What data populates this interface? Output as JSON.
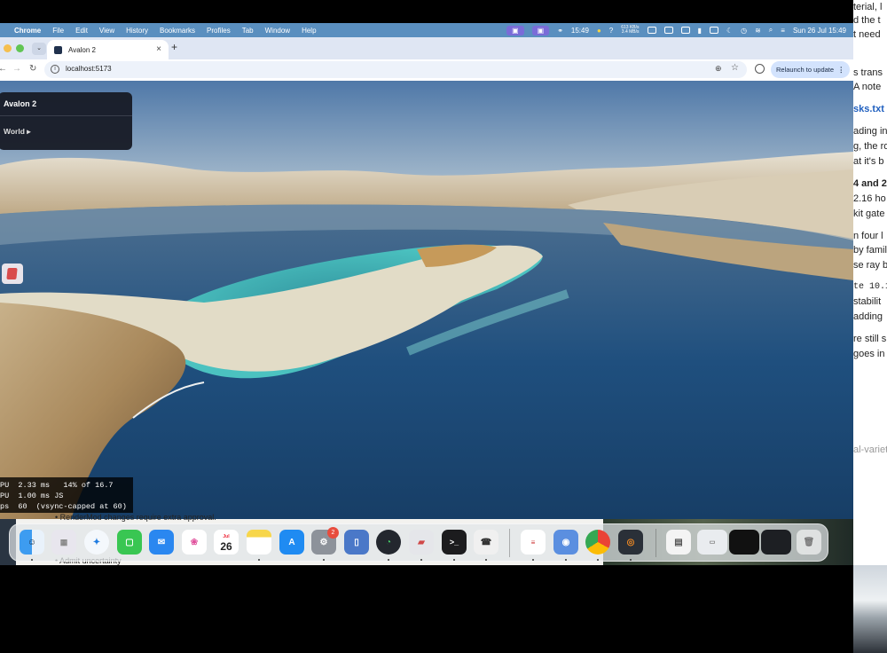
{
  "menubar": {
    "app": "Chrome",
    "items": [
      "File",
      "Edit",
      "View",
      "History",
      "Bookmarks",
      "Profiles",
      "Tab",
      "Window",
      "Help"
    ],
    "clock_short": "15:49",
    "net_up": "613 KB/s",
    "net_down": "3.4 MB/s",
    "datetime": "Sun 26 Jul  15:49"
  },
  "browser": {
    "tab_title": "Avalon 2",
    "url": "localhost:5173",
    "relaunch_label": "Relaunch to update"
  },
  "app": {
    "panel_title": "Avalon 2",
    "world_label": "World ▸",
    "stats": {
      "line1": "PU  2.33 ms   14% of 16.7",
      "line2": "PU  1.00 ms JS",
      "line3": "ps  60  (vsync-capped at 60)"
    }
  },
  "background_doc": {
    "lines": [
      "terial, l",
      "d the t",
      "t need",
      "s trans",
      "A note",
      "sks.txt",
      "ading in",
      "g, the ro",
      "at it's b",
      "4 and 2",
      "2.16 ho",
      "kit gate",
      "n four l",
      "by famil",
      "se ray b",
      "te 10.1",
      "stabilit",
      "adding",
      "re still s",
      "goes in",
      "al-variet"
    ]
  },
  "peek": {
    "text1": "• RenderMod changes require extra approval.",
    "text2": "• Admit uncertainty"
  },
  "dock": {
    "calendar_month": "Jul",
    "calendar_day": "26",
    "settings_badge": "2",
    "items": [
      "finder-icon",
      "launchpad-icon",
      "safari-icon",
      "messages-icon",
      "mail-icon",
      "photos-icon",
      "calendar-icon",
      "notes-icon",
      "app-store-icon",
      "system-settings-icon",
      "simulator-icon",
      "activity-icon",
      "xcode-icon",
      "terminal-icon",
      "phone-icon",
      "textedit-icon",
      "finder-helper-icon",
      "chrome-icon",
      "blender-icon",
      "preview-icon",
      "screenshot-icon",
      "window-thumb-icon",
      "window-thumb2-icon",
      "trash-icon"
    ]
  },
  "colors": {
    "menubar": "#5a8fbf",
    "water_deep": "#1d4a7a",
    "lagoon": "#3fb7b8",
    "sand": "#e2dcc7"
  }
}
